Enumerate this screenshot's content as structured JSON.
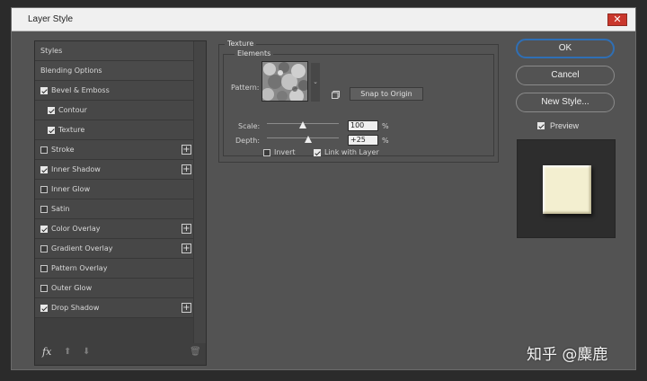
{
  "window": {
    "title": "Layer Style",
    "close_glyph": "✕"
  },
  "styles_panel": {
    "header_items": [
      {
        "label": "Styles"
      },
      {
        "label": "Blending Options"
      }
    ],
    "items": [
      {
        "label": "Bevel & Emboss",
        "checked": true,
        "sub": false,
        "selected": false,
        "plus": false
      },
      {
        "label": "Contour",
        "checked": true,
        "sub": true,
        "selected": false,
        "plus": false
      },
      {
        "label": "Texture",
        "checked": true,
        "sub": true,
        "selected": true,
        "plus": false
      },
      {
        "label": "Stroke",
        "checked": false,
        "sub": false,
        "selected": false,
        "plus": true
      },
      {
        "label": "Inner Shadow",
        "checked": true,
        "sub": false,
        "selected": false,
        "plus": true
      },
      {
        "label": "Inner Glow",
        "checked": false,
        "sub": false,
        "selected": false,
        "plus": false
      },
      {
        "label": "Satin",
        "checked": false,
        "sub": false,
        "selected": false,
        "plus": false
      },
      {
        "label": "Color Overlay",
        "checked": true,
        "sub": false,
        "selected": false,
        "plus": true
      },
      {
        "label": "Gradient Overlay",
        "checked": false,
        "sub": false,
        "selected": false,
        "plus": true
      },
      {
        "label": "Pattern Overlay",
        "checked": false,
        "sub": false,
        "selected": false,
        "plus": false
      },
      {
        "label": "Outer Glow",
        "checked": false,
        "sub": false,
        "selected": false,
        "plus": false
      },
      {
        "label": "Drop Shadow",
        "checked": true,
        "sub": false,
        "selected": false,
        "plus": true
      }
    ],
    "plus_glyph": "+",
    "footer": {
      "fx_label": "fx",
      "up_glyph": "⬆",
      "down_glyph": "⬇",
      "trash_glyph": "🗑"
    }
  },
  "texture": {
    "group_title": "Texture",
    "elements_title": "Elements",
    "pattern_label": "Pattern:",
    "pattern_arrow": "⌄",
    "snap_button": "Snap to Origin",
    "scale_label": "Scale:",
    "scale_value": "100",
    "scale_level": 0.5,
    "depth_label": "Depth:",
    "depth_value": "+25",
    "depth_level": 0.58,
    "unit": "%",
    "invert_label": "Invert",
    "invert_checked": false,
    "link_label": "Link with Layer",
    "link_checked": true
  },
  "buttons": {
    "ok": "OK",
    "cancel": "Cancel",
    "new_style": "New Style..."
  },
  "preview": {
    "label": "Preview",
    "checked": true,
    "swatch_color": "#f3efd0"
  },
  "watermark": "知乎 @麋鹿",
  "colors": {
    "dialog_bg": "#535353",
    "selected_row": "#5d5d5d",
    "ok_border": "#2f6fb5",
    "close_red": "#c9372c"
  }
}
